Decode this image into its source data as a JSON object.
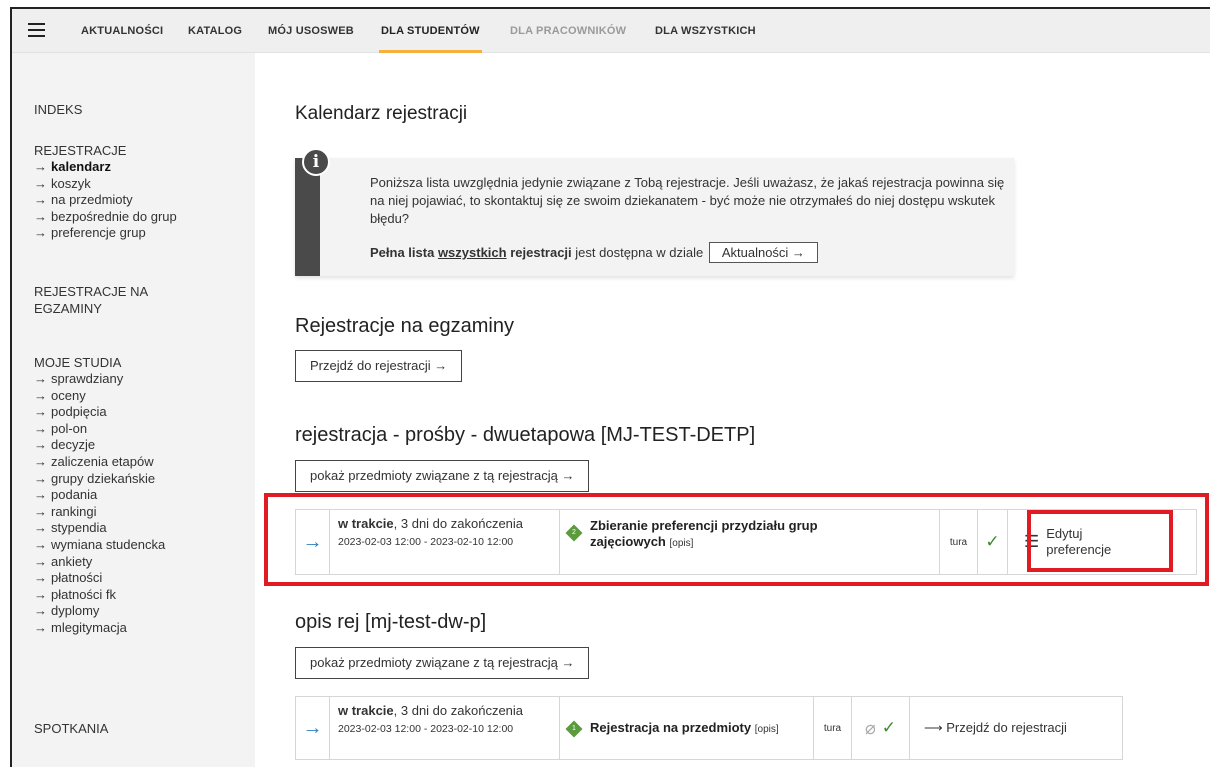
{
  "nav": {
    "items": [
      {
        "label": "AKTUALNOŚCI",
        "state": "normal"
      },
      {
        "label": "KATALOG",
        "state": "normal"
      },
      {
        "label": "MÓJ USOSWEB",
        "state": "normal"
      },
      {
        "label": "DLA STUDENTÓW",
        "state": "active"
      },
      {
        "label": "DLA PRACOWNIKÓW",
        "state": "disabled"
      },
      {
        "label": "DLA WSZYSTKICH",
        "state": "normal"
      }
    ]
  },
  "sidebar": {
    "indeks": "INDEKS",
    "rejestracje": {
      "heading": "REJESTRACJE",
      "items": [
        "kalendarz",
        "koszyk",
        "na przedmioty",
        "bezpośrednie do grup",
        "preferencje grup"
      ],
      "current": "kalendarz"
    },
    "rejestracje_egz": {
      "line1": "REJESTRACJE NA",
      "line2": "EGZAMINY"
    },
    "moje_studia": {
      "heading": "MOJE STUDIA",
      "items": [
        "sprawdziany",
        "oceny",
        "podpięcia",
        "pol-on",
        "decyzje",
        "zaliczenia etapów",
        "grupy dziekańskie",
        "podania",
        "rankingi",
        "stypendia",
        "wymiana studencka",
        "ankiety",
        "płatności",
        "płatności fk",
        "dyplomy",
        "mlegitymacja"
      ]
    },
    "spotkania": "SPOTKANIA"
  },
  "main": {
    "title": "Kalendarz rejestracji",
    "info": {
      "text": "Poniższa lista uwzględnia jedynie związane z Tobą rejestracje. Jeśli uważasz, że jakaś rejestracja powinna się na niej pojawiać, to skontaktuj się ze swoim dziekanatem - być może nie otrzymałeś do niej dostępu wskutek błędu?",
      "footer_pre": "Pełna lista",
      "footer_link": "wszystkich",
      "footer_bold": "rejestracji",
      "footer_post": "jest dostępna w dziale",
      "button": "Aktualności →"
    },
    "exams": {
      "heading": "Rejestracje na egzaminy",
      "button": "Przejdź do rejestracji →"
    },
    "reg1": {
      "heading": "rejestracja - prośby - dwuetapowa [MJ-TEST-DETP]",
      "button": "pokaż przedmioty związane z tą rejestracją →",
      "arrow": "→",
      "status_bold": "w trakcie",
      "status_rest": ", 3 dni do zakończenia",
      "dates": "2023-02-03 12:00 - 2023-02-10 12:00",
      "diamond_label": "2",
      "name_line1": "Zbieranie preferencji przydziału grup",
      "name_line2": "zajęciowych",
      "opis": "[opis]",
      "tura": "tura",
      "check": "✓",
      "action_line1": "Edytuj",
      "action_line2": "preferencje"
    },
    "reg2": {
      "heading": "opis rej [mj-test-dw-p]",
      "button": "pokaż przedmioty związane z tą rejestracją →",
      "arrow": "→",
      "status_bold": "w trakcie",
      "status_rest": ", 3 dni do zakończenia",
      "dates": "2023-02-03 12:00 - 2023-02-10 12:00",
      "diamond_label": "1",
      "name": "Rejestracja na przedmioty",
      "opis": "[opis]",
      "tura": "tura",
      "check": "✓",
      "action": "⟶ Przejdź do rejestracji"
    }
  },
  "colors": {
    "accent": "#f5b13a",
    "highlight": "#e01b24",
    "arrow": "#2d7fc1",
    "diamond": "#5c9a3e"
  }
}
